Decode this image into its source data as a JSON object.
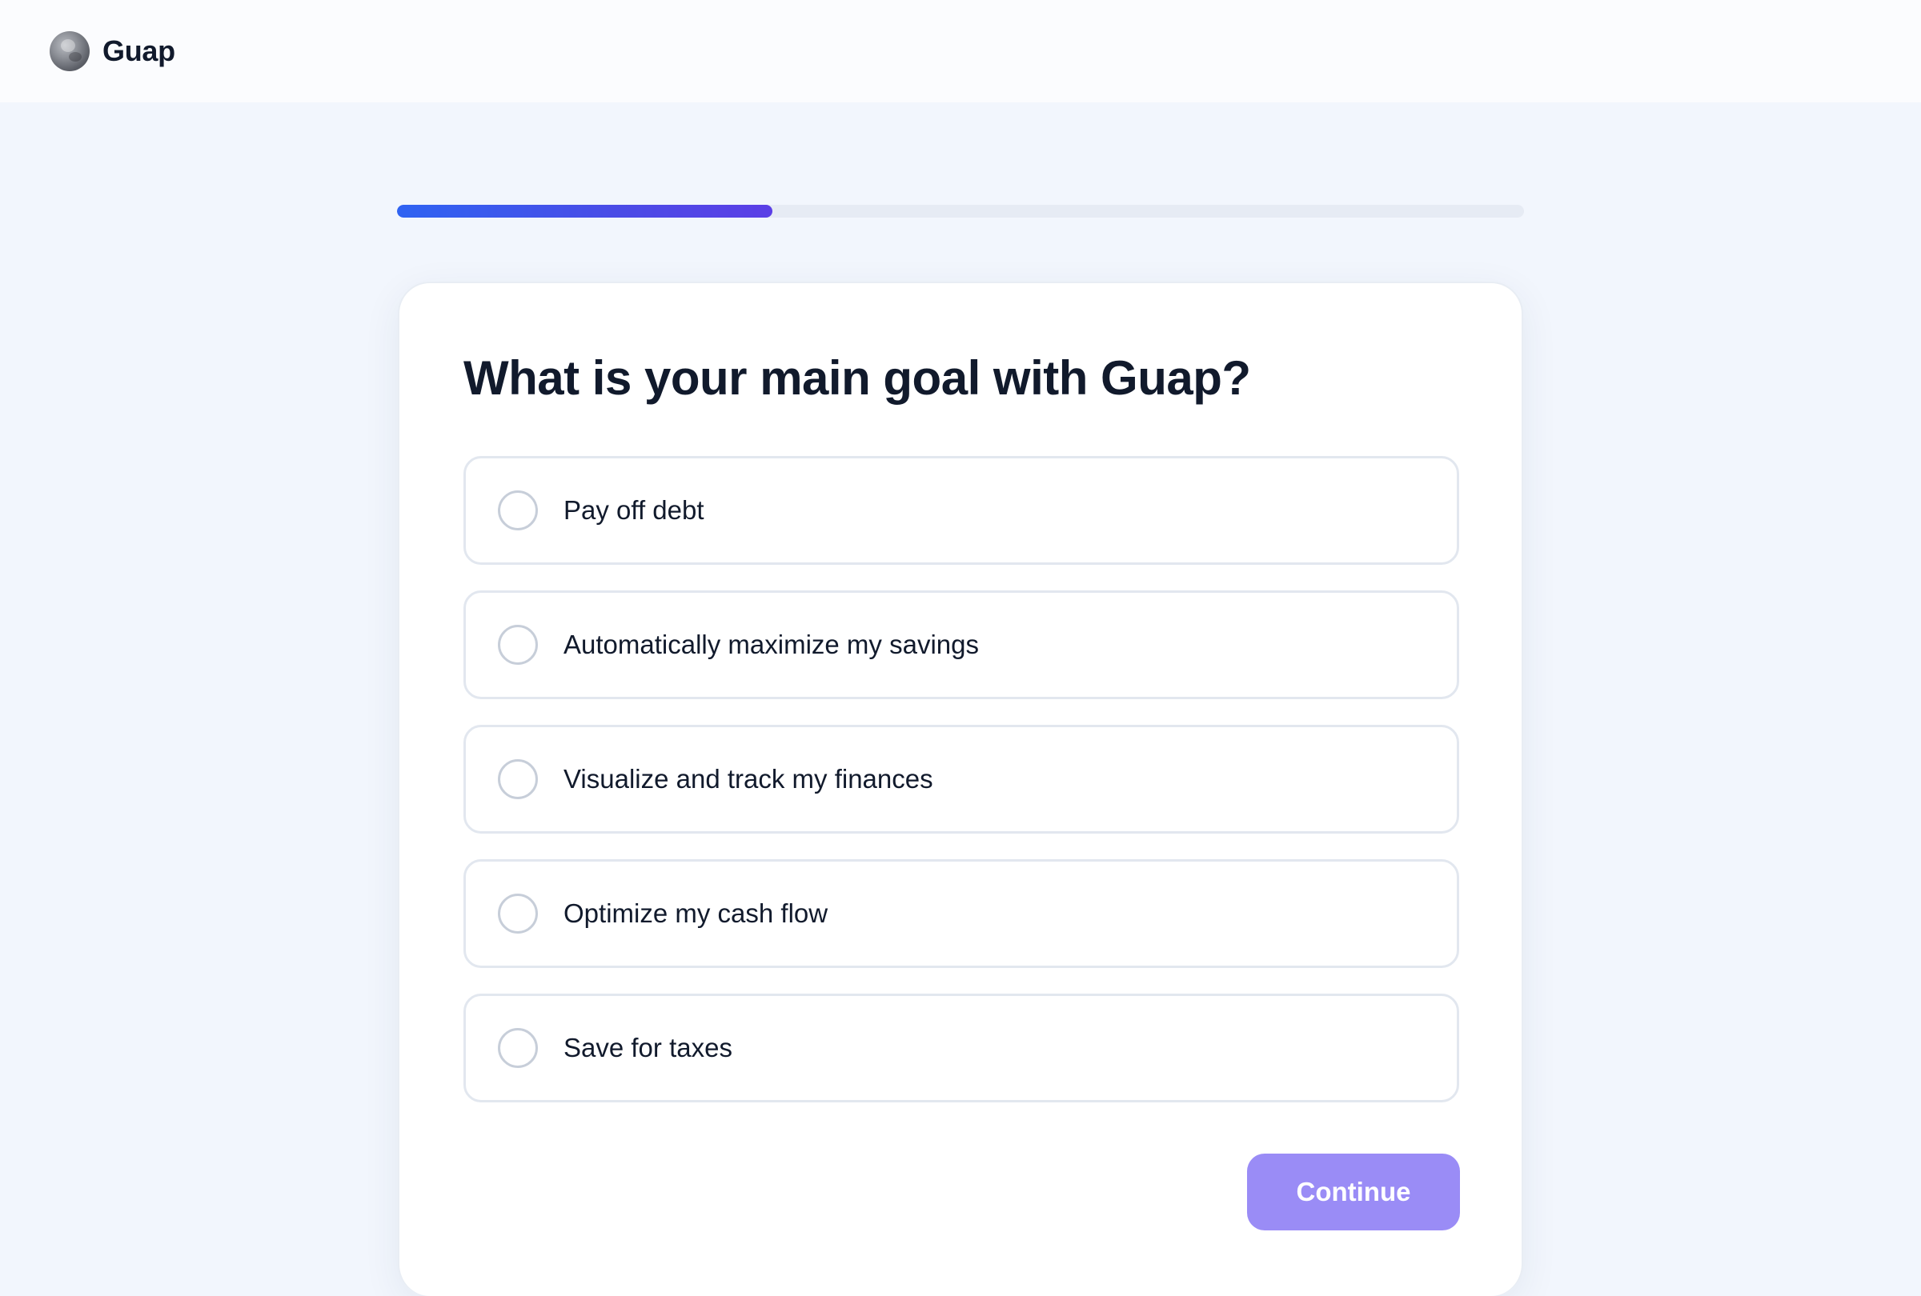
{
  "header": {
    "brand_name": "Guap",
    "logo_icon": "coin-globe-icon"
  },
  "progress": {
    "fraction": 0.333
  },
  "question": {
    "title": "What is your main goal with Guap?"
  },
  "options": [
    {
      "label": "Pay off debt",
      "selected": false
    },
    {
      "label": "Automatically maximize my savings",
      "selected": false
    },
    {
      "label": "Visualize and track my finances",
      "selected": false
    },
    {
      "label": "Optimize my cash flow",
      "selected": false
    },
    {
      "label": "Save for taxes",
      "selected": false
    }
  ],
  "actions": {
    "continue_label": "Continue",
    "continue_enabled": false
  },
  "colors": {
    "accent_start": "#2f63f2",
    "accent_end": "#5b3fe6",
    "button_disabled": "#9a8cf6",
    "page_background": "#f2f6fd"
  }
}
